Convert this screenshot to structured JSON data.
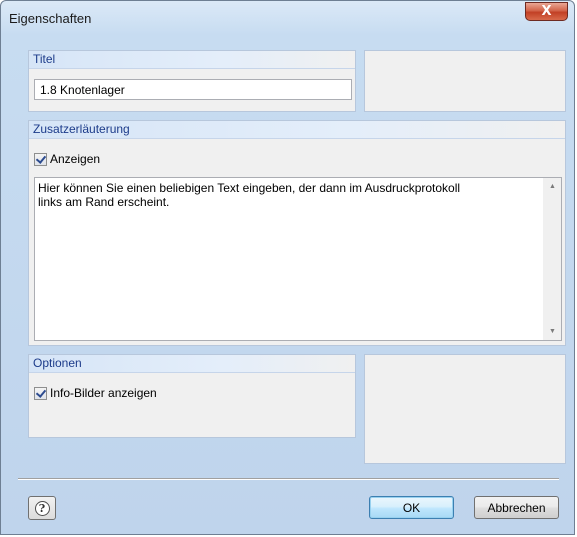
{
  "window": {
    "title": "Eigenschaften",
    "close_label": "X"
  },
  "titel": {
    "heading": "Titel",
    "value": "1.8 Knotenlager"
  },
  "zusatz": {
    "heading": "Zusatzerläuterung",
    "checkbox_label": "Anzeigen",
    "checked": true,
    "text_line1": "Hier können Sie einen beliebigen Text eingeben, der dann im Ausdruckprotokoll",
    "text_line2": "links am Rand erscheint."
  },
  "optionen": {
    "heading": "Optionen",
    "checkbox_label": "Info-Bilder anzeigen",
    "checked": true
  },
  "footer": {
    "ok_label": "OK",
    "cancel_label": "Abbrechen"
  },
  "icons": {
    "help": "help-icon",
    "close": "close-icon",
    "scroll_up": "scroll-up-icon",
    "scroll_down": "scroll-down-icon"
  }
}
